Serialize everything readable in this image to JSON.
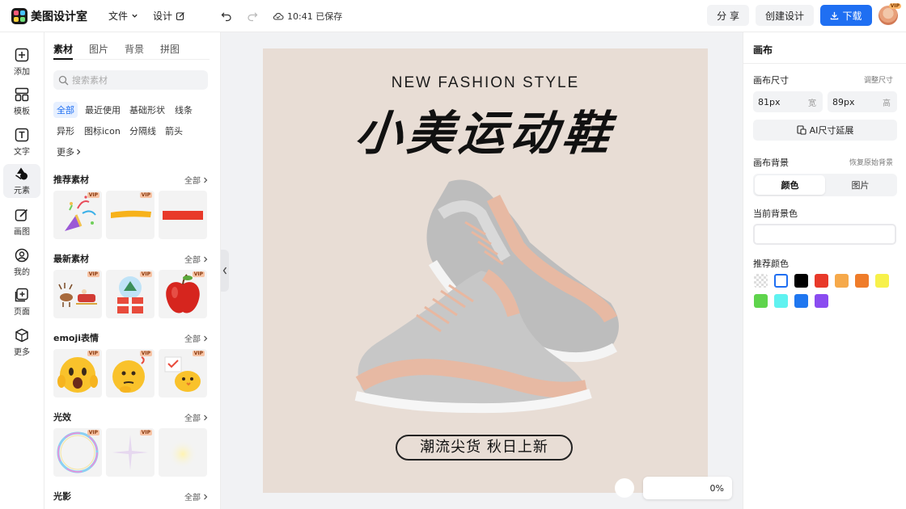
{
  "app": {
    "name": "美图设计室",
    "saved_status": "10:41 已保存"
  },
  "menu": {
    "file": "文件",
    "design": "设计"
  },
  "toolbar": {
    "share": "分 享",
    "create": "创建设计",
    "download": "下载",
    "vip_badge": "VIP"
  },
  "rail": [
    {
      "label": "添加",
      "icon": "plus-square-icon"
    },
    {
      "label": "模板",
      "icon": "template-grid-icon"
    },
    {
      "label": "文字",
      "icon": "text-t-icon"
    },
    {
      "label": "元素",
      "icon": "shapes-icon"
    },
    {
      "label": "画图",
      "icon": "pencil-icon"
    },
    {
      "label": "我的",
      "icon": "user-icon"
    },
    {
      "label": "页面",
      "icon": "page-plus-icon"
    },
    {
      "label": "更多",
      "icon": "cube-icon"
    }
  ],
  "assets": {
    "tabs": [
      "素材",
      "图片",
      "背景",
      "拼图"
    ],
    "search_placeholder": "搜索素材",
    "chips": [
      "全部",
      "最近使用",
      "基础形状",
      "线条",
      "异形",
      "图标icon",
      "分隔线",
      "箭头",
      "更多"
    ],
    "more_label": "全部",
    "vip": "VIP",
    "sections": [
      {
        "title": "推荐素材",
        "items": [
          "party-popper",
          "yellow-brush-stroke",
          "red-bar"
        ]
      },
      {
        "title": "最新素材",
        "items": [
          "reindeer-sleigh",
          "snow-globe-gift",
          "red-apple"
        ]
      },
      {
        "title": "emoji表情",
        "items": [
          "shocked-emoji",
          "thinking-emoji",
          "chick-emoji"
        ]
      },
      {
        "title": "光效",
        "items": [
          "bubble-ring",
          "sparkle-star",
          "soft-glow"
        ]
      },
      {
        "title": "光影",
        "items": []
      }
    ]
  },
  "canvas": {
    "subtitle": "NEW FASHION STYLE",
    "title": "小美运动鞋",
    "tag": "潮流尖货 秋日上新",
    "background": "#e8ddd5",
    "zoom": "0%"
  },
  "props": {
    "header": "画布",
    "size_label": "画布尺寸",
    "size_adjust": "调整尺寸",
    "width_value": "81px",
    "width_unit": "宽",
    "height_value": "89px",
    "height_unit": "高",
    "ai_extend": "AI尺寸延展",
    "bg_label": "画布背景",
    "bg_reset": "恢复原始背景",
    "bg_mode_color": "颜色",
    "bg_mode_image": "图片",
    "current_bg_label": "当前背景色",
    "recommended_label": "推荐颜色",
    "swatches": [
      "transparent",
      "#ffffff",
      "#000000",
      "#e8392a",
      "#f6a94a",
      "#ef7c2a",
      "#f7f14a",
      "#5fd44c",
      "#5ff2f0",
      "#1f77f0",
      "#8a4cf0"
    ],
    "accent": "#1f6ff2"
  }
}
